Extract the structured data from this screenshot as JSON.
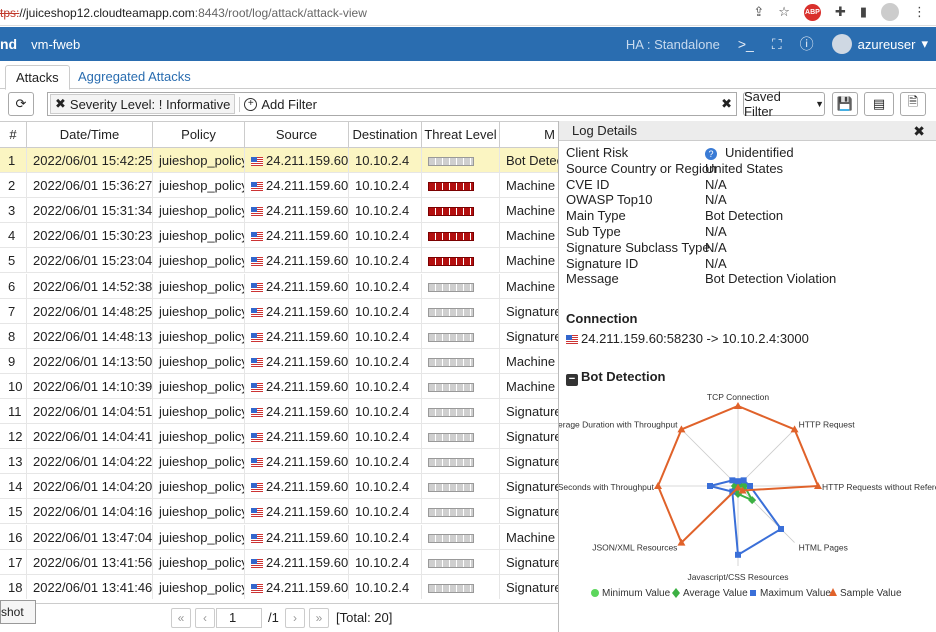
{
  "browser": {
    "url_scheme": "tps:",
    "url_host": "//juiceshop12.cloudteamapp.com",
    "url_path": ":8443/root/log/attack/attack-view",
    "extension_badge": "ABP"
  },
  "header": {
    "brand": "nd",
    "vm": "vm-fweb",
    "ha": "HA : Standalone",
    "user": "azureuser"
  },
  "tabs": [
    {
      "label": "Attacks",
      "active": true
    },
    {
      "label": "Aggregated Attacks",
      "active": false
    }
  ],
  "toolbar": {
    "filter_chip": "Severity Level:  ! Informative",
    "add_filter": "Add Filter",
    "saved_filter": "Saved Filter"
  },
  "table": {
    "columns": [
      "#",
      "Date/Time",
      "Policy",
      "Source",
      "Destination",
      "Threat Level",
      "M"
    ],
    "rows": [
      {
        "n": "1",
        "dt": "2022/06/01 15:42:25",
        "policy": "juieshop_policy",
        "src": "24.211.159.60",
        "dst": "10.10.2.4",
        "level": "low",
        "msg": "Bot Detec",
        "selected": true
      },
      {
        "n": "2",
        "dt": "2022/06/01 15:36:27",
        "policy": "juieshop_policy",
        "src": "24.211.159.60",
        "dst": "10.10.2.4",
        "level": "high",
        "msg": "Machine l"
      },
      {
        "n": "3",
        "dt": "2022/06/01 15:31:34",
        "policy": "juieshop_policy",
        "src": "24.211.159.60",
        "dst": "10.10.2.4",
        "level": "high",
        "msg": "Machine l"
      },
      {
        "n": "4",
        "dt": "2022/06/01 15:30:23",
        "policy": "juieshop_policy",
        "src": "24.211.159.60",
        "dst": "10.10.2.4",
        "level": "high",
        "msg": "Machine l"
      },
      {
        "n": "5",
        "dt": "2022/06/01 15:23:04",
        "policy": "juieshop_policy",
        "src": "24.211.159.60",
        "dst": "10.10.2.4",
        "level": "high",
        "msg": "Machine l"
      },
      {
        "n": "6",
        "dt": "2022/06/01 14:52:38",
        "policy": "juieshop_policy",
        "src": "24.211.159.60",
        "dst": "10.10.2.4",
        "level": "low",
        "msg": "Machine l"
      },
      {
        "n": "7",
        "dt": "2022/06/01 14:48:25",
        "policy": "juieshop_policy",
        "src": "24.211.159.60",
        "dst": "10.10.2.4",
        "level": "low",
        "msg": "Signature"
      },
      {
        "n": "8",
        "dt": "2022/06/01 14:48:13",
        "policy": "juieshop_policy",
        "src": "24.211.159.60",
        "dst": "10.10.2.4",
        "level": "low",
        "msg": "Signature"
      },
      {
        "n": "9",
        "dt": "2022/06/01 14:13:50",
        "policy": "juieshop_policy",
        "src": "24.211.159.60",
        "dst": "10.10.2.4",
        "level": "low",
        "msg": "Machine l"
      },
      {
        "n": "10",
        "dt": "2022/06/01 14:10:39",
        "policy": "juieshop_policy",
        "src": "24.211.159.60",
        "dst": "10.10.2.4",
        "level": "low",
        "msg": "Machine l"
      },
      {
        "n": "11",
        "dt": "2022/06/01 14:04:51",
        "policy": "juieshop_policy",
        "src": "24.211.159.60",
        "dst": "10.10.2.4",
        "level": "low",
        "msg": "Signature"
      },
      {
        "n": "12",
        "dt": "2022/06/01 14:04:41",
        "policy": "juieshop_policy",
        "src": "24.211.159.60",
        "dst": "10.10.2.4",
        "level": "low",
        "msg": "Signature"
      },
      {
        "n": "13",
        "dt": "2022/06/01 14:04:22",
        "policy": "juieshop_policy",
        "src": "24.211.159.60",
        "dst": "10.10.2.4",
        "level": "low",
        "msg": "Signature"
      },
      {
        "n": "14",
        "dt": "2022/06/01 14:04:20",
        "policy": "juieshop_policy",
        "src": "24.211.159.60",
        "dst": "10.10.2.4",
        "level": "low",
        "msg": "Signature"
      },
      {
        "n": "15",
        "dt": "2022/06/01 14:04:16",
        "policy": "juieshop_policy",
        "src": "24.211.159.60",
        "dst": "10.10.2.4",
        "level": "low",
        "msg": "Signature"
      },
      {
        "n": "16",
        "dt": "2022/06/01 13:47:04",
        "policy": "juieshop_policy",
        "src": "24.211.159.60",
        "dst": "10.10.2.4",
        "level": "low",
        "msg": "Machine l"
      },
      {
        "n": "17",
        "dt": "2022/06/01 13:41:56",
        "policy": "juieshop_policy",
        "src": "24.211.159.60",
        "dst": "10.10.2.4",
        "level": "low",
        "msg": "Signature"
      },
      {
        "n": "18",
        "dt": "2022/06/01 13:41:46",
        "policy": "juieshop_policy",
        "src": "24.211.159.60",
        "dst": "10.10.2.4",
        "level": "low",
        "msg": "Signature"
      }
    ]
  },
  "pager": {
    "page": "1",
    "of": "/1",
    "total": "[Total: 20]",
    "shot_label": "shot"
  },
  "details": {
    "title": "Log Details",
    "fields": [
      {
        "k": "Client Risk",
        "v": "Unidentified",
        "help": true
      },
      {
        "k": "Source Country or Region",
        "v": "United States"
      },
      {
        "k": "CVE ID",
        "v": "N/A"
      },
      {
        "k": "OWASP Top10",
        "v": "N/A"
      },
      {
        "k": "Main Type",
        "v": "Bot Detection"
      },
      {
        "k": "Sub Type",
        "v": "N/A"
      },
      {
        "k": "Signature Subclass Type",
        "v": "N/A"
      },
      {
        "k": "Signature ID",
        "v": "N/A"
      },
      {
        "k": "Message",
        "v": "Bot Detection Violation"
      }
    ],
    "connection_title": "Connection",
    "connection": "24.211.159.60:58230 -> 10.10.2.4:3000",
    "bot_title": "Bot Detection"
  },
  "chart_data": {
    "type": "radar",
    "axes": [
      "TCP Connection",
      "HTTP Request",
      "HTTP Requests without Referer",
      "HTML Pages",
      "Javascript/CSS Resources",
      "JSON/XML Resources",
      "Seconds with Throughput",
      "verage Duration with Throughput"
    ],
    "series": [
      {
        "name": "Minimum Value",
        "color": "#5cd65c",
        "values": [
          0.02,
          0.02,
          0.02,
          0.02,
          0.02,
          0.02,
          0.02,
          0.02
        ]
      },
      {
        "name": "Average Value",
        "color": "#3cb043",
        "values": [
          0.02,
          0.03,
          0.08,
          0.25,
          0.1,
          0.05,
          0.04,
          0.03
        ]
      },
      {
        "name": "Maximum Value",
        "color": "#3a6fd8",
        "values": [
          0.06,
          0.1,
          0.15,
          0.76,
          0.86,
          0.1,
          0.35,
          0.1
        ]
      },
      {
        "name": "Sample Value",
        "color": "#e0622a",
        "values": [
          1,
          1,
          1,
          0.08,
          0.02,
          1,
          1,
          1
        ]
      }
    ]
  }
}
